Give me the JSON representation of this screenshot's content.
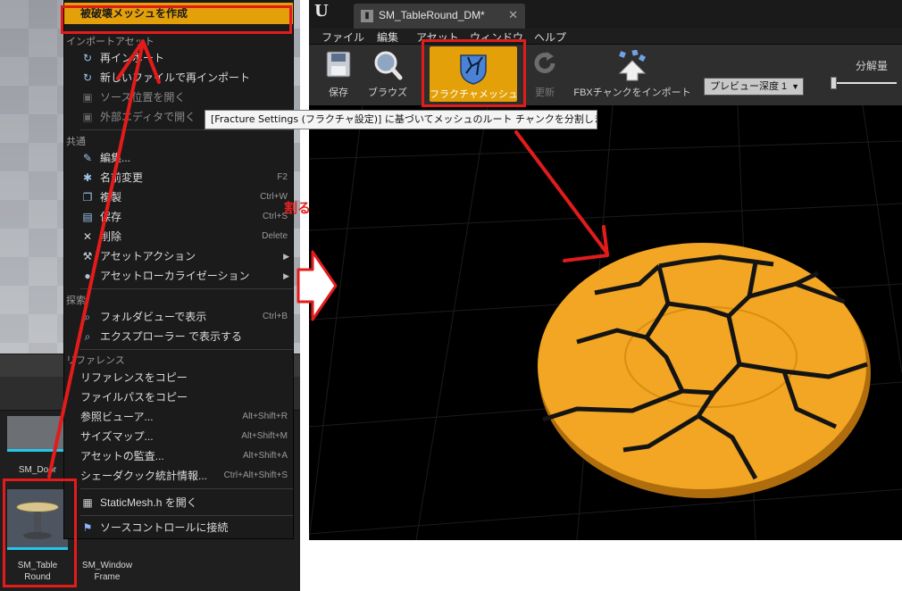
{
  "content_browser": {
    "assets": [
      {
        "name": "SM_Door"
      },
      {
        "name": "SM_Table Round",
        "line1": "SM_Table",
        "line2": "Round"
      },
      {
        "name": "SM_Window Frame",
        "line1": "SM_Window",
        "line2": "Frame"
      }
    ]
  },
  "context_menu": {
    "highlighted_item": "被破壊メッシュを作成",
    "sections": {
      "import_assets": "インポートアセット",
      "common": "共通",
      "explore": "探索",
      "references": "リファレンス"
    },
    "import_items": [
      {
        "label": "再インポート"
      },
      {
        "label": "新しいファイルで再インポート"
      },
      {
        "label": "ソース位置を開く"
      },
      {
        "label": "外部エディタで開く"
      }
    ],
    "common_items": [
      {
        "label": "編集...",
        "shortcut": ""
      },
      {
        "label": "名前変更",
        "shortcut": "F2"
      },
      {
        "label": "複製",
        "shortcut": "Ctrl+W"
      },
      {
        "label": "保存",
        "shortcut": "Ctrl+S"
      },
      {
        "label": "削除",
        "shortcut": "Delete"
      },
      {
        "label": "アセットアクション",
        "shortcut": ""
      },
      {
        "label": "アセットローカライゼーション",
        "shortcut": ""
      }
    ],
    "explore_items": [
      {
        "label": "フォルダビューで表示",
        "shortcut": "Ctrl+B"
      },
      {
        "label": "エクスプローラー で表示する",
        "shortcut": ""
      }
    ],
    "reference_items": [
      {
        "label": "リファレンスをコピー",
        "shortcut": ""
      },
      {
        "label": "ファイルパスをコピー",
        "shortcut": ""
      },
      {
        "label": "参照ビューア...",
        "shortcut": "Alt+Shift+R"
      },
      {
        "label": "サイズマップ...",
        "shortcut": "Alt+Shift+M"
      },
      {
        "label": "アセットの監査...",
        "shortcut": "Alt+Shift+A"
      },
      {
        "label": "シェーダクック統計情報...",
        "shortcut": "Ctrl+Alt+Shift+S"
      }
    ],
    "bottom_items": [
      {
        "label": "StaticMesh.h を開く"
      },
      {
        "label": "ソースコントロールに接続"
      }
    ]
  },
  "editor": {
    "tab_title": "SM_TableRound_DM*",
    "menus": [
      "ファイル",
      "編集",
      "アセット",
      "ウィンドウ",
      "ヘルプ"
    ],
    "toolbar": {
      "save": "保存",
      "browse": "ブラウズ",
      "fracture": "フラクチャメッシュ",
      "refresh": "更新",
      "import_fbx": "FBXチャンクをインポート",
      "preview_depth": "プレビュー深度 1",
      "split_label": "分解量",
      "split_level": 0
    },
    "tooltip": "[Fracture Settings (フラクチャ設定)] に基づいてメッシュのルート チャンクを分割しま"
  },
  "annotation": {
    "label": "割る",
    "color": "#e31b1b"
  },
  "colors": {
    "highlight": "#e3a008",
    "mesh": "#f2a623",
    "asset_underline": "#25c6e8"
  }
}
